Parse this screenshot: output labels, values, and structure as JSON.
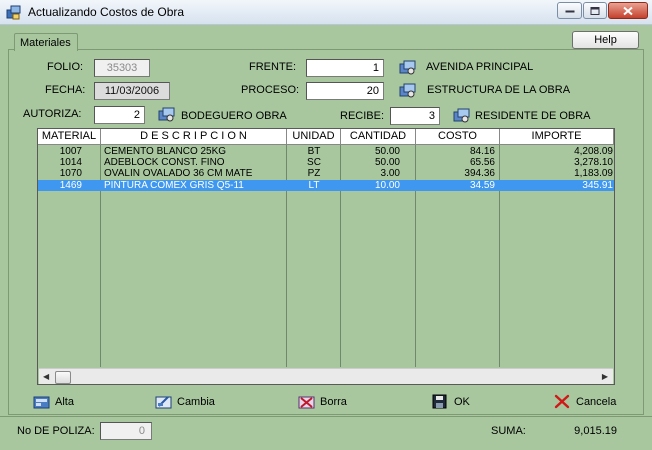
{
  "window": {
    "title": "Actualizando Costos de Obra",
    "minimize_label": "_",
    "maximize_label": "□",
    "close_label": "×"
  },
  "tabs": [
    {
      "label": "Materiales"
    }
  ],
  "help_label": "Help",
  "form": {
    "folio": {
      "label": "FOLIO:",
      "value": "35303"
    },
    "fecha": {
      "label": "FECHA:",
      "value": "11/03/2006"
    },
    "frente": {
      "label": "FRENTE:",
      "value": "1",
      "desc": "AVENIDA PRINCIPAL"
    },
    "proceso": {
      "label": "PROCESO:",
      "value": "20",
      "desc": "ESTRUCTURA DE LA OBRA"
    },
    "autoriza": {
      "label": "AUTORIZA:",
      "value": "2",
      "desc": "BODEGUERO OBRA"
    },
    "recibe": {
      "label": "RECIBE:",
      "value": "3",
      "desc": "RESIDENTE DE OBRA"
    }
  },
  "grid": {
    "columns": [
      "MATERIAL",
      "D E S C R I P C I O N",
      "UNIDAD",
      "CANTIDAD",
      "COSTO",
      "IMPORTE"
    ],
    "rows": [
      {
        "material": "1007",
        "descripcion": "CEMENTO BLANCO 25KG",
        "unidad": "BT",
        "cantidad": "50.00",
        "costo": "84.16",
        "importe": "4,208.09",
        "selected": false
      },
      {
        "material": "1014",
        "descripcion": "ADEBLOCK CONST. FINO",
        "unidad": "SC",
        "cantidad": "50.00",
        "costo": "65.56",
        "importe": "3,278.10",
        "selected": false
      },
      {
        "material": "1070",
        "descripcion": "OVALIN OVALADO 36 CM MATE",
        "unidad": "PZ",
        "cantidad": "3.00",
        "costo": "394.36",
        "importe": "1,183.09",
        "selected": false
      },
      {
        "material": "1469",
        "descripcion": "PINTURA COMEX GRIS Q5-11",
        "unidad": "LT",
        "cantidad": "10.00",
        "costo": "34.59",
        "importe": "345.91",
        "selected": true
      }
    ]
  },
  "actions": {
    "alta": "Alta",
    "cambia": "Cambia",
    "borra": "Borra",
    "ok": "OK",
    "cancela": "Cancela"
  },
  "footer": {
    "poliza_label": "No DE POLIZA:",
    "poliza_value": "0",
    "suma_label": "SUMA:",
    "suma_value": "9,015.19"
  },
  "colors": {
    "background": "#a8c79f",
    "selection": "#3f97ef"
  },
  "icons": [
    "app-icon",
    "lookup-icon",
    "add-icon",
    "edit-icon",
    "delete-icon",
    "save-icon",
    "cancel-x-icon"
  ]
}
